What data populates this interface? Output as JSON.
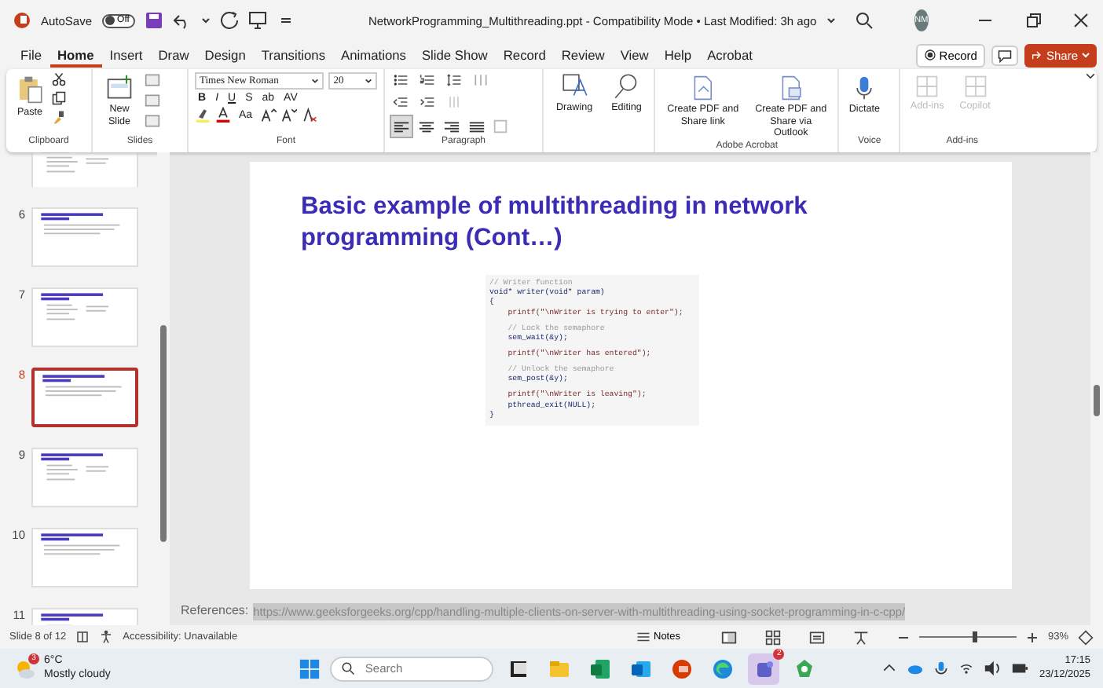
{
  "title_bar": {
    "autosave_label": "AutoSave",
    "autosave": {
      "on": false,
      "label": "Off"
    },
    "title": "NetworkProgramming_Multithreading.ppt  -  Compatibility Mode • Last Modified: 3h ago",
    "avatar": "NM"
  },
  "tabs": [
    {
      "label": "File",
      "selected": false
    },
    {
      "label": "Home",
      "selected": true
    },
    {
      "label": "Insert",
      "selected": false
    },
    {
      "label": "Draw",
      "selected": false
    },
    {
      "label": "Design",
      "selected": false
    },
    {
      "label": "Transitions",
      "selected": false
    },
    {
      "label": "Animations",
      "selected": false
    },
    {
      "label": "Slide Show",
      "selected": false
    },
    {
      "label": "Record",
      "selected": false
    },
    {
      "label": "Review",
      "selected": false
    },
    {
      "label": "View",
      "selected": false
    },
    {
      "label": "Help",
      "selected": false
    },
    {
      "label": "Acrobat",
      "selected": false
    }
  ],
  "tab_actions": {
    "record": "Record",
    "share": "Share"
  },
  "ribbon": {
    "clipboard": {
      "label": "Clipboard",
      "paste": "Paste"
    },
    "slides": {
      "label": "Slides",
      "new_slide": "New Slide"
    },
    "font": {
      "label": "Font",
      "family": "Times New Roman",
      "size": "20",
      "style_buttons": [
        "B",
        "I",
        "U",
        "S",
        "ab",
        "AV"
      ],
      "change_case": "Aa"
    },
    "paragraph": {
      "label": "Paragraph",
      "align": [
        {
          "kind": "left",
          "selected": true
        },
        {
          "kind": "center",
          "selected": false
        },
        {
          "kind": "right",
          "selected": false
        },
        {
          "kind": "justify",
          "selected": false
        }
      ]
    },
    "tools": [
      {
        "label": "Drawing",
        "kind": "drawing"
      },
      {
        "label": "Editing",
        "kind": "editing"
      }
    ],
    "acrobat": {
      "label": "Adobe Acrobat",
      "buttons": [
        {
          "label": "Create PDF and Share link",
          "kind": "pdf-link"
        },
        {
          "label": "Create PDF and Share via Outlook",
          "kind": "pdf-outlook"
        }
      ]
    },
    "voice": {
      "label": "Voice",
      "dictate": "Dictate"
    },
    "addins": {
      "label": "Add-ins",
      "buttons": [
        {
          "label": "Add-ins",
          "disabled": true
        },
        {
          "label": "Copilot",
          "disabled": true
        }
      ]
    }
  },
  "thumbnails": [
    {
      "selected": false
    },
    {
      "number": "6",
      "selected": false
    },
    {
      "number": "7",
      "selected": false
    },
    {
      "number": "8",
      "selected": true
    },
    {
      "number": "9",
      "selected": false
    },
    {
      "number": "10",
      "selected": false
    },
    {
      "number": "11",
      "selected": false
    }
  ],
  "slide": {
    "title": "Basic example of multithreading in network programming (Cont…)",
    "code": [
      [
        {
          "kind": "comment",
          "text": "// Writer function"
        },
        {
          "kind": "code",
          "text": "void* writer(void* param)"
        },
        {
          "kind": "code",
          "text": "{"
        },
        {
          "kind": "string",
          "text": "    printf(\"\\nWriter is trying to enter\");"
        }
      ],
      [
        {
          "kind": "comment",
          "text": "    // Lock the semaphore"
        },
        {
          "kind": "code",
          "text": "    sem_wait(&y);"
        }
      ],
      [
        {
          "kind": "string",
          "text": "    printf(\"\\nWriter has entered\");"
        }
      ],
      [
        {
          "kind": "comment",
          "text": "    // Unlock the semaphore"
        },
        {
          "kind": "code",
          "text": "    sem_post(&y);"
        }
      ],
      [
        {
          "kind": "string",
          "text": "    printf(\"\\nWriter is leaving\");"
        },
        {
          "kind": "code",
          "text": "    pthread_exit(NULL);"
        },
        {
          "kind": "code",
          "text": "}"
        }
      ]
    ]
  },
  "references": {
    "label": "References:",
    "link": "https://www.geeksforgeeks.org/cpp/handling-multiple-clients-on-server-with-multithreading-using-socket-programming-in-c-cpp/"
  },
  "status_bar": {
    "slide": "Slide 8 of 12",
    "accessibility": "Accessibility: Unavailable",
    "notes": "Notes",
    "zoom": {
      "level": 0.55,
      "reading": "93%"
    }
  },
  "taskbar": {
    "weather": {
      "badge": "3",
      "temperature": "6°C",
      "condition": "Mostly cloudy"
    },
    "search": {
      "placeholder": "Search"
    },
    "apps": [
      {
        "kind": "taskview",
        "active": false
      },
      {
        "kind": "explorer",
        "active": false
      },
      {
        "kind": "excel",
        "active": false
      },
      {
        "kind": "outlook",
        "active": false
      },
      {
        "kind": "office",
        "active": false
      },
      {
        "kind": "edge",
        "active": false
      },
      {
        "kind": "teams",
        "active": true,
        "badge": "2"
      },
      {
        "kind": "green",
        "active": false
      }
    ],
    "time": "17:15",
    "date": "23/12/2025"
  }
}
